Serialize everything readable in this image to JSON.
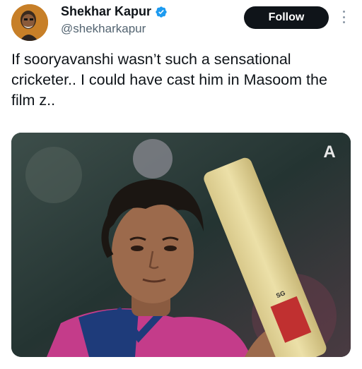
{
  "author": {
    "name": "Shekhar Kapur",
    "handle": "@shekharkapur",
    "verified_icon": "verified-badge-icon",
    "verified_color": "#1d9bf0"
  },
  "actions": {
    "follow_label": "Follow",
    "more_icon": "more-vertical-icon"
  },
  "tweet": {
    "text": "If sooryavanshi wasn’t such a sensational cricketer.. I could have cast him in Masoom the film z.."
  },
  "media": {
    "watermark": "A",
    "bat_label": "SG"
  },
  "colors": {
    "follow_bg": "#0f1419",
    "text_primary": "#0f1419",
    "text_secondary": "#536471"
  }
}
